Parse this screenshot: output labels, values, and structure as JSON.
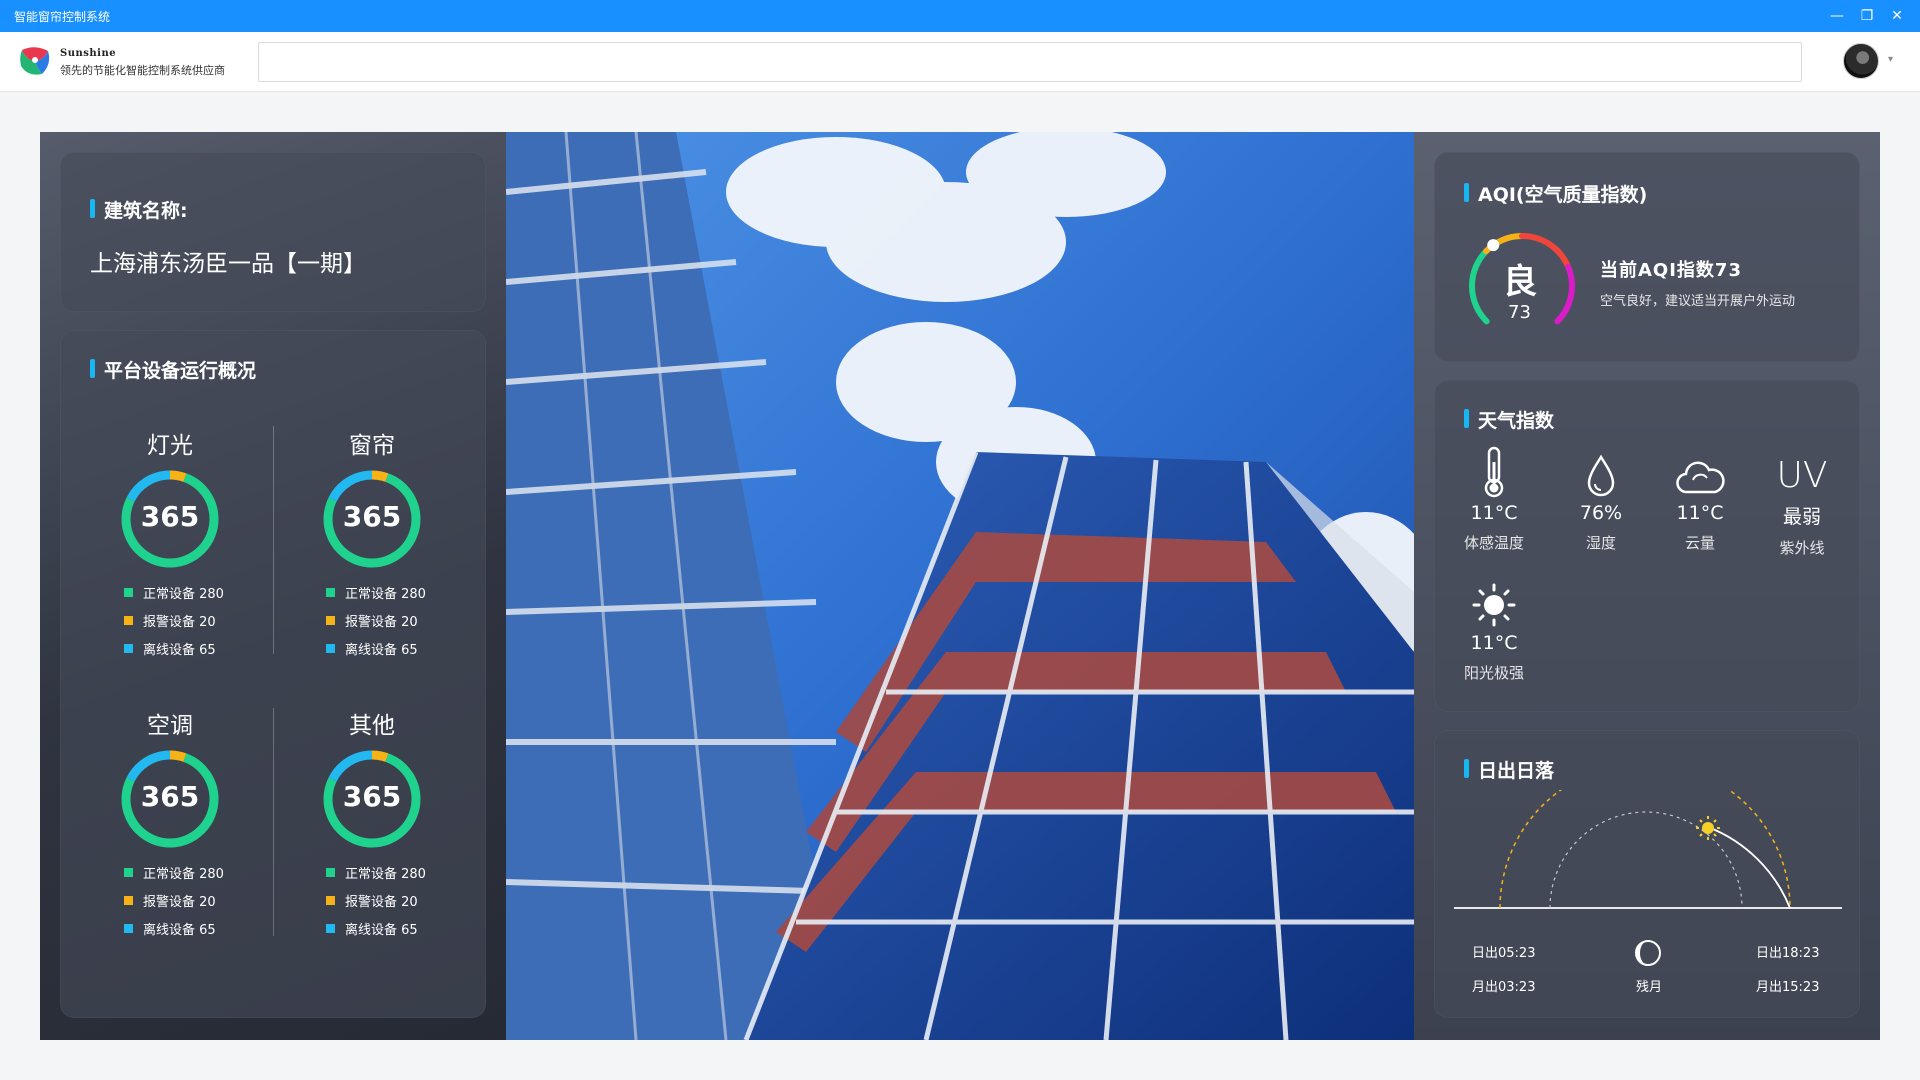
{
  "window": {
    "title": "智能窗帘控制系统",
    "minimize_glyph": "—",
    "restore_glyph": "❐",
    "close_glyph": "✕"
  },
  "header": {
    "brand_name": "Sunshine",
    "brand_tagline": "领先的节能化智能控制系统供应商",
    "search_value": "",
    "caret_glyph": "▾"
  },
  "building": {
    "label": "建筑名称:",
    "name": "上海浦东汤臣一品【一期】"
  },
  "devices": {
    "title": "平台设备运行概况",
    "items": [
      {
        "name": "灯光",
        "total": "365",
        "normal": "正常设备 280",
        "alarm": "报警设备 20",
        "offline": "离线设备 65",
        "normal_pct": 0.767,
        "alarm_pct": 0.055,
        "offline_pct": 0.178
      },
      {
        "name": "窗帘",
        "total": "365",
        "normal": "正常设备 280",
        "alarm": "报警设备 20",
        "offline": "离线设备 65",
        "normal_pct": 0.767,
        "alarm_pct": 0.055,
        "offline_pct": 0.178
      },
      {
        "name": "空调",
        "total": "365",
        "normal": "正常设备 280",
        "alarm": "报警设备 20",
        "offline": "离线设备 65",
        "normal_pct": 0.767,
        "alarm_pct": 0.055,
        "offline_pct": 0.178
      },
      {
        "name": "其他",
        "total": "365",
        "normal": "正常设备 280",
        "alarm": "报警设备 20",
        "offline": "离线设备 65",
        "normal_pct": 0.767,
        "alarm_pct": 0.055,
        "offline_pct": 0.178
      }
    ],
    "colors": {
      "normal": "#1fd38e",
      "alarm": "#f5b317",
      "offline": "#22b8f0"
    }
  },
  "aqi": {
    "title": "AQI(空气质量指数)",
    "grade": "良",
    "value": "73",
    "headline": "当前AQI指数73",
    "advice": "空气良好，建议适当开展户外运动",
    "level": 0.37
  },
  "weather": {
    "title": "天气指数",
    "items": [
      {
        "icon": "thermometer-icon",
        "value": "11°C",
        "label": "体感温度"
      },
      {
        "icon": "humidity-drop-icon",
        "value": "76%",
        "label": "湿度"
      },
      {
        "icon": "cloud-icon",
        "value": "11°C",
        "label": "云量"
      },
      {
        "icon": "uv-icon",
        "icon_text": "UV",
        "value": "最弱",
        "label": "紫外线"
      },
      {
        "icon": "sun-icon",
        "value": "11°C",
        "label": "阳光极强"
      }
    ]
  },
  "sun": {
    "title": "日出日落",
    "sunrise": "日出05:23",
    "moonrise": "月出03:23",
    "sunset": "日出18:23",
    "moonset": "月出15:23",
    "moon_phase": "残月"
  }
}
